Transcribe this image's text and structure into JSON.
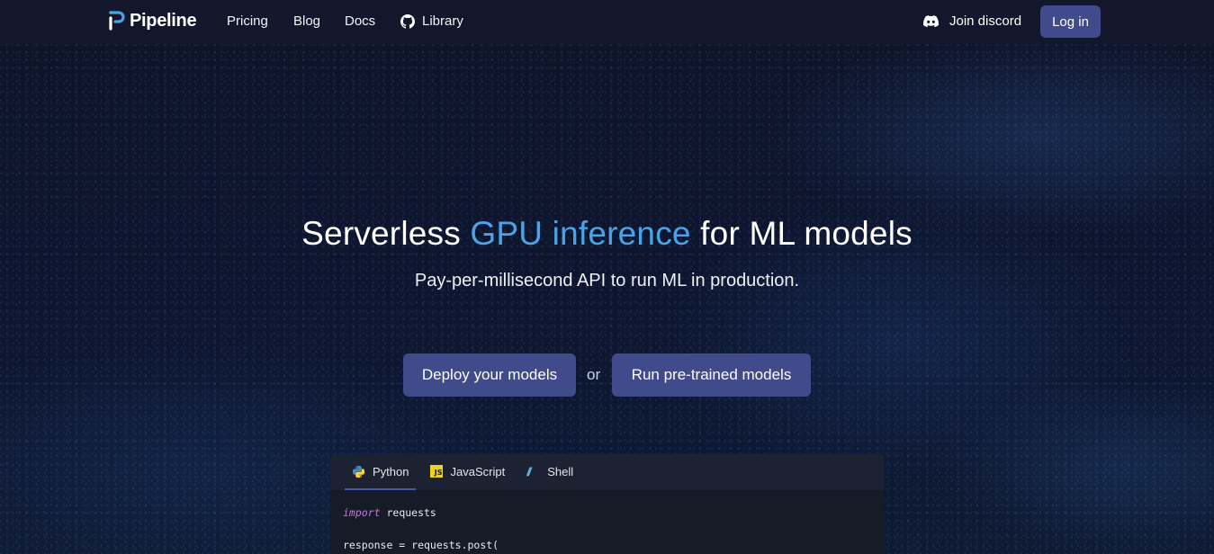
{
  "nav": {
    "brand": "Pipeline",
    "links": [
      {
        "label": "Pricing"
      },
      {
        "label": "Blog"
      },
      {
        "label": "Docs"
      },
      {
        "label": "Library",
        "icon": "github-icon"
      }
    ],
    "discord": {
      "label": "Join discord",
      "icon": "discord-icon"
    },
    "login_label": "Log in"
  },
  "hero": {
    "title_before": "Serverless ",
    "title_accent": "GPU inference",
    "title_after": " for ML models",
    "subtitle": "Pay-per-millisecond API to run ML in production.",
    "primary_cta": "Deploy your models",
    "or_text": "or",
    "secondary_cta": "Run pre-trained models"
  },
  "code_panel": {
    "tabs": [
      {
        "label": "Python",
        "icon": "python-icon",
        "active": true
      },
      {
        "label": "JavaScript",
        "icon": "js-icon",
        "active": false
      },
      {
        "label": "Shell",
        "icon": "shell-icon",
        "active": false
      }
    ],
    "lines": [
      {
        "keyword": "import",
        "text": " requests"
      },
      {
        "keyword": "",
        "text": ""
      },
      {
        "keyword": "",
        "text": "response = requests.post("
      }
    ]
  },
  "colors": {
    "accent_text": "#4aa3e8",
    "button": "#414a8a",
    "nav_bg": "#13172b",
    "page_bg": "#0e1326"
  },
  "js_icon_text": "JS"
}
